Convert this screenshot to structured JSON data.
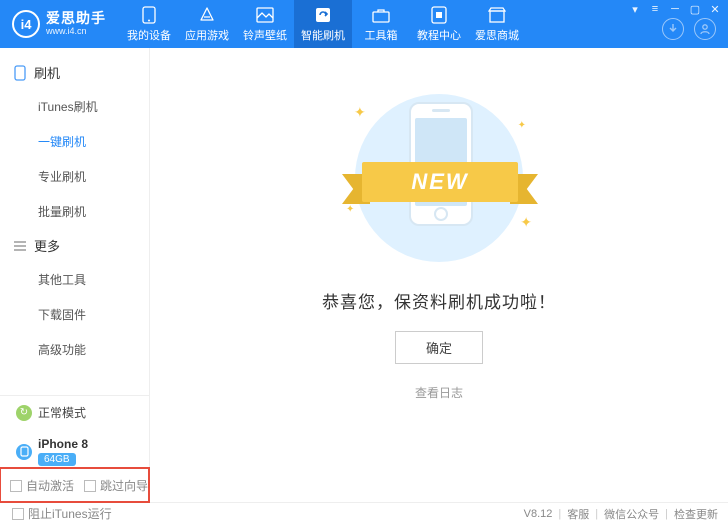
{
  "app": {
    "name": "爱思助手",
    "url": "www.i4.cn"
  },
  "tabs": [
    {
      "id": "device",
      "label": "我的设备"
    },
    {
      "id": "apps",
      "label": "应用游戏"
    },
    {
      "id": "ring",
      "label": "铃声壁纸"
    },
    {
      "id": "flash",
      "label": "智能刷机",
      "active": true
    },
    {
      "id": "toolbox",
      "label": "工具箱"
    },
    {
      "id": "help",
      "label": "教程中心"
    },
    {
      "id": "store",
      "label": "爱思商城"
    }
  ],
  "sidebar": {
    "group1": {
      "title": "刷机",
      "items": [
        {
          "label": "iTunes刷机"
        },
        {
          "label": "一键刷机",
          "active": true
        },
        {
          "label": "专业刷机"
        },
        {
          "label": "批量刷机"
        }
      ]
    },
    "group2": {
      "title": "更多",
      "items": [
        {
          "label": "其他工具"
        },
        {
          "label": "下载固件"
        },
        {
          "label": "高级功能"
        }
      ]
    },
    "mode": "正常模式",
    "device": {
      "name": "iPhone 8",
      "storage": "64GB"
    },
    "checks": {
      "auto_activate": "自动激活",
      "skip_guide": "跳过向导"
    }
  },
  "main": {
    "ribbon": "NEW",
    "message": "恭喜您，保资料刷机成功啦！",
    "ok": "确定",
    "log": "查看日志"
  },
  "footer": {
    "block_itunes": "阻止iTunes运行",
    "version": "V8.12",
    "service": "客服",
    "wechat": "微信公众号",
    "update": "检查更新"
  }
}
